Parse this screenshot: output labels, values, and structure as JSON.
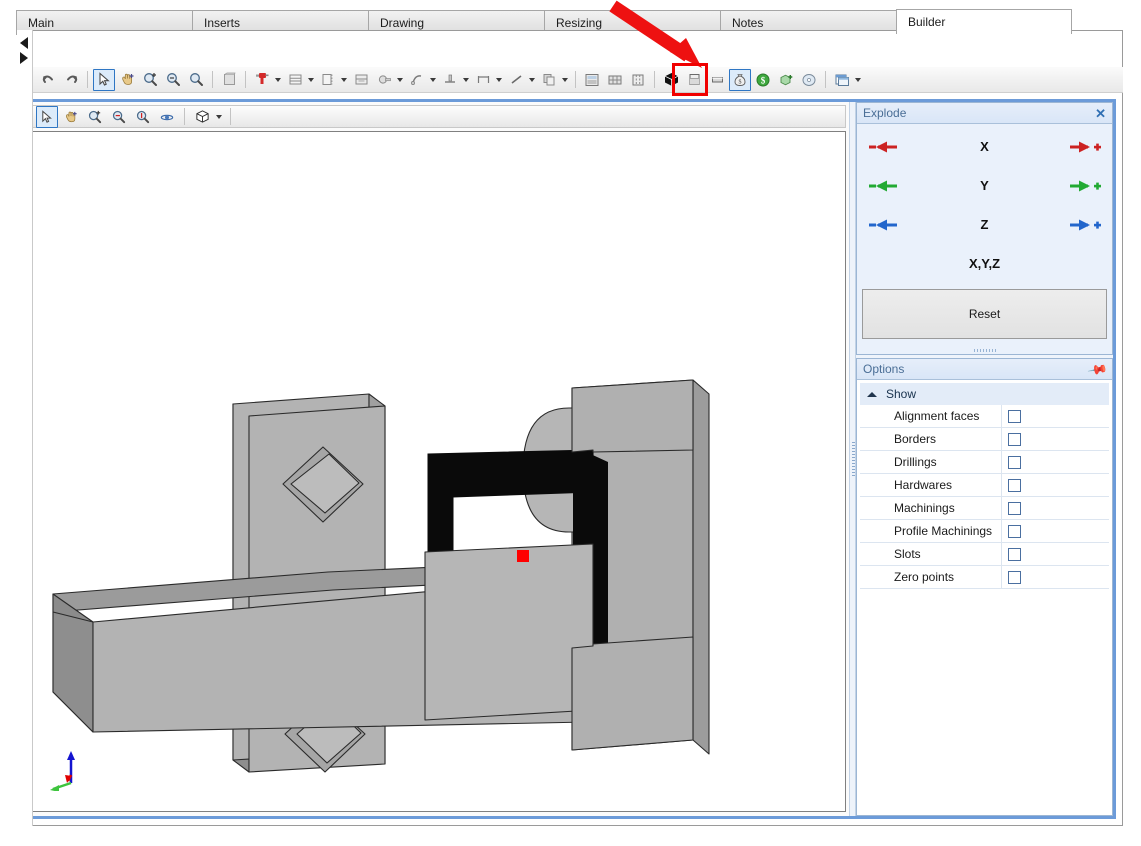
{
  "window": {
    "nav_prev_icon": "triangle-left-icon",
    "nav_next_icon": "triangle-right-icon"
  },
  "tabs": [
    {
      "label": "Main",
      "active": false
    },
    {
      "label": "Inserts",
      "active": false
    },
    {
      "label": "Drawing",
      "active": false
    },
    {
      "label": "Resizing",
      "active": false
    },
    {
      "label": "Notes",
      "active": false
    },
    {
      "label": "Builder",
      "active": true
    }
  ],
  "main_toolbar": {
    "items": [
      {
        "name": "undo-icon",
        "type": "button"
      },
      {
        "name": "redo-icon",
        "type": "button"
      },
      {
        "name": "separator-1",
        "type": "separator"
      },
      {
        "name": "select-arrow-icon",
        "type": "button",
        "selected": true
      },
      {
        "name": "pan-hand-icon",
        "type": "button"
      },
      {
        "name": "zoom-in-icon",
        "type": "button"
      },
      {
        "name": "zoom-out-icon",
        "type": "button"
      },
      {
        "name": "zoom-window-icon",
        "type": "button"
      },
      {
        "name": "separator-2",
        "type": "separator"
      },
      {
        "name": "panel-icon",
        "type": "button"
      },
      {
        "name": "separator-3",
        "type": "separator"
      },
      {
        "name": "drill-icon",
        "type": "dropdown"
      },
      {
        "name": "shelf-icon",
        "type": "dropdown"
      },
      {
        "name": "door-icon",
        "type": "dropdown"
      },
      {
        "name": "drawer-icon",
        "type": "button"
      },
      {
        "name": "hardware-icon",
        "type": "dropdown"
      },
      {
        "name": "machining-icon",
        "type": "dropdown"
      },
      {
        "name": "groove-icon",
        "type": "dropdown"
      },
      {
        "name": "dimension-icon",
        "type": "dropdown"
      },
      {
        "name": "edge-icon",
        "type": "dropdown"
      },
      {
        "name": "copy-icon",
        "type": "dropdown"
      },
      {
        "name": "separator-4",
        "type": "separator"
      },
      {
        "name": "material-icon",
        "type": "button"
      },
      {
        "name": "grid-icon",
        "type": "button"
      },
      {
        "name": "columns-icon",
        "type": "button"
      },
      {
        "name": "separator-5",
        "type": "separator"
      },
      {
        "name": "solid-box-icon",
        "type": "button"
      },
      {
        "name": "cabinet-icon",
        "type": "button"
      },
      {
        "name": "panel2-icon",
        "type": "button"
      },
      {
        "name": "money-bag-icon",
        "type": "button",
        "selected": true,
        "highlighted": true
      },
      {
        "name": "dollar-icon",
        "type": "button"
      },
      {
        "name": "add-box-icon",
        "type": "button"
      },
      {
        "name": "disc-icon",
        "type": "button"
      },
      {
        "name": "separator-6",
        "type": "separator"
      },
      {
        "name": "window-icon",
        "type": "dropdown"
      }
    ]
  },
  "viewport_toolbar": {
    "items": [
      {
        "name": "select-arrow-icon",
        "selected": true
      },
      {
        "name": "pan-hand-icon",
        "selected": false
      },
      {
        "name": "zoom-in-icon",
        "selected": false
      },
      {
        "name": "zoom-out-icon",
        "selected": false
      },
      {
        "name": "zoom-extents-icon",
        "selected": false
      },
      {
        "name": "orbit-icon",
        "selected": false
      },
      {
        "name": "separator",
        "selected": false
      },
      {
        "name": "view-cube-icon",
        "selected": false,
        "dropdown": true
      }
    ]
  },
  "viewport": {
    "axis_gizmo": {
      "x_color": "#e00000",
      "y_color": "#3ec43e",
      "z_color": "#1414d0"
    },
    "selection_marker_color": "#ff0000",
    "model_fill": "#b0b0b0",
    "model_fill_dark": "#8e8e8e",
    "model_fill_top": "#9a9a9a",
    "model_cavity": "#000000"
  },
  "explode_panel": {
    "title": "Explode",
    "close_label": "✕",
    "rows": [
      {
        "label": "X",
        "color": "#cc2222",
        "has_arrows": true
      },
      {
        "label": "Y",
        "color": "#22aa33",
        "has_arrows": true
      },
      {
        "label": "Z",
        "color": "#2266cc",
        "has_arrows": true
      },
      {
        "label": "X,Y,Z",
        "color": "#000000",
        "has_arrows": false
      }
    ],
    "reset_label": "Reset"
  },
  "options_panel": {
    "title": "Options",
    "pin_icon": "pin-icon",
    "group_label": "Show",
    "rows": [
      {
        "label": "Alignment faces",
        "checked": false
      },
      {
        "label": "Borders",
        "checked": false
      },
      {
        "label": "Drillings",
        "checked": false
      },
      {
        "label": "Hardwares",
        "checked": false
      },
      {
        "label": "Machinings",
        "checked": false
      },
      {
        "label": "Profile Machinings",
        "checked": false
      },
      {
        "label": "Slots",
        "checked": false
      },
      {
        "label": "Zero points",
        "checked": false
      }
    ]
  },
  "annotation": {
    "arrow_color": "#ee1111",
    "box_color": "#f00000",
    "target_icon": "money-bag-icon"
  }
}
